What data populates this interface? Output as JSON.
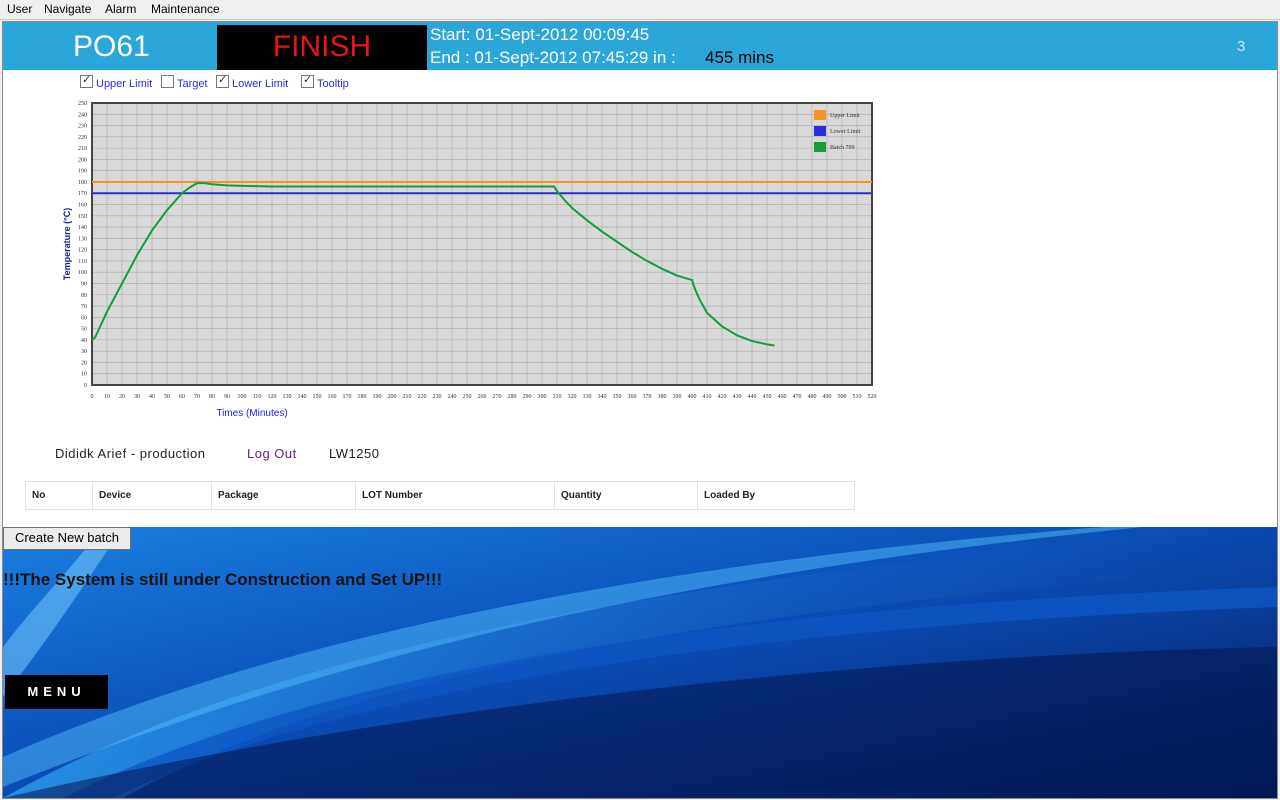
{
  "menubar": {
    "items": [
      {
        "label": "User"
      },
      {
        "label": "Navigate"
      },
      {
        "label": "Alarm"
      },
      {
        "label": "Maintenance"
      }
    ]
  },
  "header": {
    "machine": "PO61",
    "status": "FINISH",
    "start_text": "Start: 01-Sept-2012 00:09:45",
    "end_text": "End : 01-Sept-2012 07:45:29 in :",
    "duration": "455 mins",
    "page_number": "3",
    "colors": {
      "band": "#2aa6d8",
      "status_text": "#e8141a"
    }
  },
  "options": [
    {
      "label": "Upper Limit",
      "checked": true
    },
    {
      "label": "Target",
      "checked": false
    },
    {
      "label": "Lower Limit",
      "checked": true
    },
    {
      "label": "Tooltip",
      "checked": true
    }
  ],
  "chart_data": {
    "type": "line",
    "xlabel": "Times (Minutes)",
    "ylabel": "Temperature (°C)",
    "xlim": [
      0,
      520
    ],
    "ylim": [
      0,
      250
    ],
    "x_step": 10,
    "y_step": 10,
    "grid": true,
    "legend_position": "top-right",
    "series": [
      {
        "name": "Upper Limit",
        "color": "#f7931e",
        "x": [
          0,
          520
        ],
        "y": [
          180,
          180
        ]
      },
      {
        "name": "Lower Limit",
        "color": "#2b2bdb",
        "x": [
          0,
          520
        ],
        "y": [
          170,
          170
        ]
      },
      {
        "name": "Batch 709",
        "color": "#169b3c",
        "x": [
          0,
          2,
          10,
          20,
          30,
          40,
          50,
          60,
          65,
          70,
          75,
          80,
          90,
          100,
          120,
          140,
          160,
          200,
          250,
          290,
          300,
          305,
          308,
          310,
          315,
          320,
          330,
          340,
          350,
          360,
          370,
          380,
          390,
          395,
          400,
          402,
          405,
          410,
          420,
          430,
          440,
          450,
          455
        ],
        "y": [
          40,
          42,
          65,
          90,
          115,
          137,
          155,
          170,
          175,
          179,
          179,
          178,
          177,
          176.5,
          176,
          176,
          176,
          176,
          176,
          176,
          176,
          176,
          176,
          172,
          164,
          157,
          146,
          136,
          127,
          118,
          110,
          103,
          97,
          95,
          93,
          85,
          76,
          64,
          52,
          44,
          39,
          36,
          35
        ]
      }
    ]
  },
  "user_row": {
    "user": "Dididk Arief - production",
    "logout": "Log Out",
    "line": "LW1250"
  },
  "table": {
    "headers": [
      "No",
      "Device",
      "Package",
      "LOT Number",
      "Quantity",
      "Loaded By"
    ]
  },
  "actions": {
    "create_batch": "Create New batch",
    "notice": "!!!The System is still under Construction and Set UP!!!",
    "menu": "MENU"
  }
}
